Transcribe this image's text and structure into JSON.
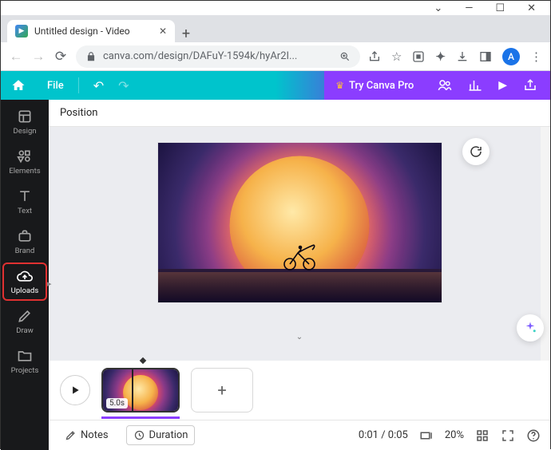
{
  "window": {
    "tab_title": "Untitled design - Video"
  },
  "browser": {
    "url": "canva.com/design/DAFuY-1594k/hyAr2I...",
    "avatar_initial": "A"
  },
  "canva_bar": {
    "file": "File",
    "try_pro": "Try Canva Pro"
  },
  "sidebar": {
    "items": [
      {
        "label": "Design"
      },
      {
        "label": "Elements"
      },
      {
        "label": "Text"
      },
      {
        "label": "Brand"
      },
      {
        "label": "Uploads"
      },
      {
        "label": "Draw"
      },
      {
        "label": "Projects"
      }
    ]
  },
  "context": {
    "position": "Position"
  },
  "timeline": {
    "clip_duration": "5.0s"
  },
  "bottom": {
    "notes": "Notes",
    "duration": "Duration",
    "time": "0:01 / 0:05",
    "zoom": "20%"
  }
}
